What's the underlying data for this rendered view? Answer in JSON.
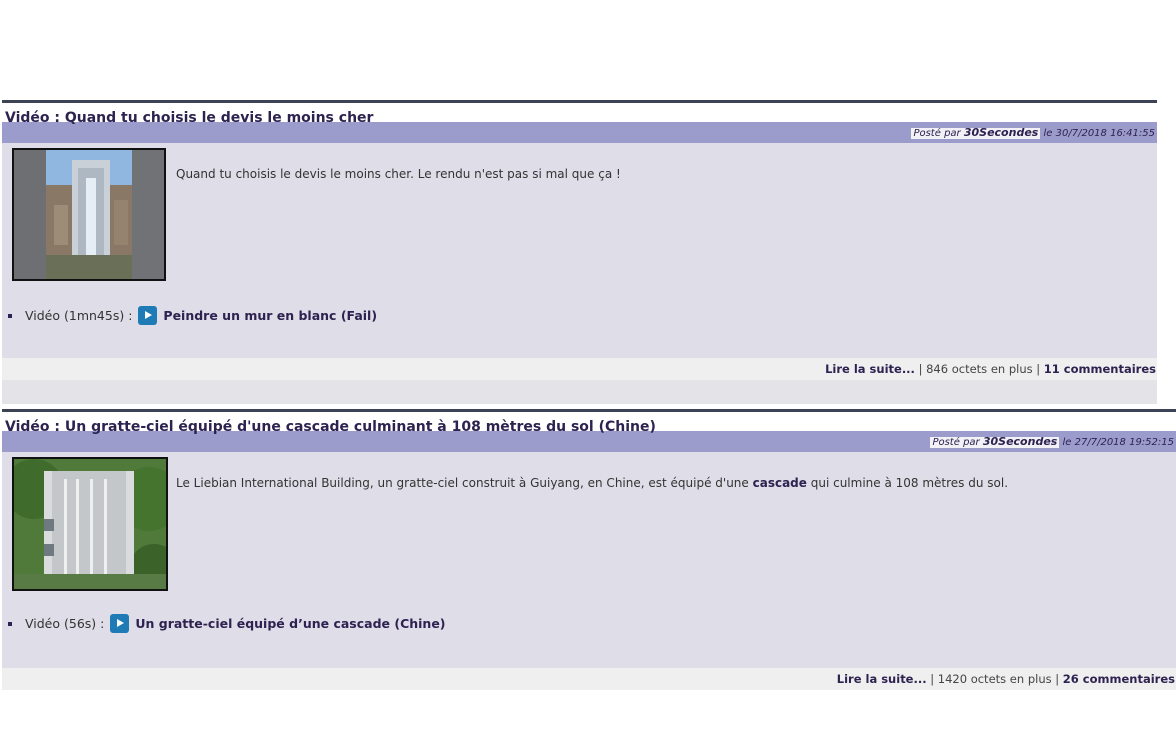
{
  "articles": [
    {
      "title": "Vidéo : Quand tu choisis le devis le moins cher",
      "meta": {
        "posted_by": "Posté par",
        "author": "30Secondes",
        "date": "le 30/7/2018 16:41:55"
      },
      "thumbnail": "building-waterfall-photo",
      "summary": "Quand tu choisis le devis le moins cher. Le rendu n'est pas si mal que ça !",
      "video": {
        "label": "Vidéo (1mn45s) :",
        "link": "Peindre un mur en blanc (Fail)"
      },
      "footer": {
        "read_more": "Lire la suite...",
        "sep1": " | ",
        "bytes": "846 octets en plus",
        "sep2": " | ",
        "comments": "11 commentaires"
      }
    },
    {
      "title": "Vidéo : Un gratte-ciel équipé d'une cascade culminant à 108 mètres du sol (Chine)",
      "meta": {
        "posted_by": "Posté par",
        "author": "30Secondes",
        "date": "le 27/7/2018 19:52:15"
      },
      "thumbnail": "painted-wall-photo",
      "summary_pre": "Le Liebian International Building, un gratte-ciel construit à Guiyang, en Chine, est équipé d'une ",
      "summary_bold": "cascade",
      "summary_post": " qui culmine à 108 mètres du sol.",
      "video": {
        "label": "Vidéo (56s) :",
        "link": "Un gratte-ciel équipé d’une cascade (Chine)"
      },
      "footer": {
        "read_more": "Lire la suite...",
        "sep1": " | ",
        "bytes": "1420 octets en plus",
        "sep2": " | ",
        "comments": "26 commentaires"
      }
    }
  ],
  "colors": {
    "title": "#2d2250",
    "meta_bar": "#9c9ccc",
    "content_bg": "#dfdde7",
    "play_icon": "#1e7bb5"
  }
}
